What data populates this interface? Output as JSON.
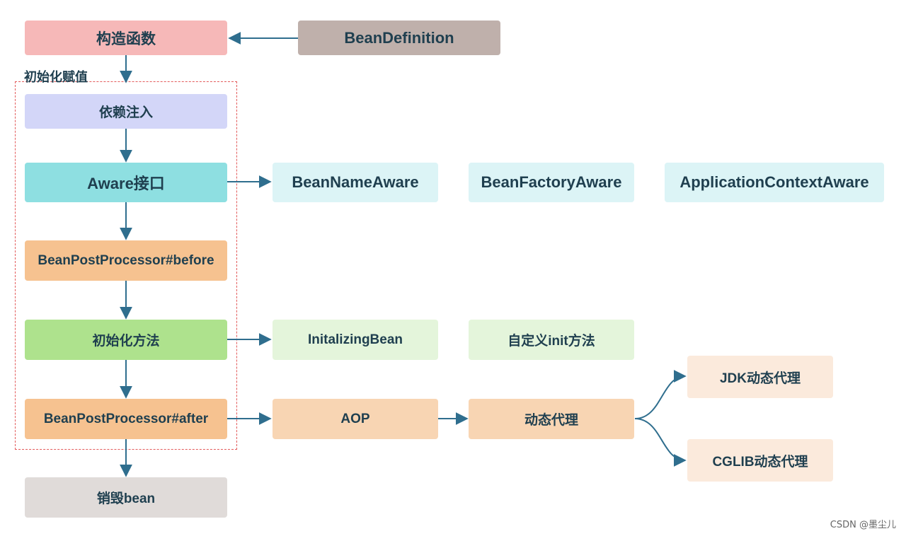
{
  "diagram": {
    "region_label": "初始化赋值",
    "nodes": {
      "constructor": {
        "label": "构造函数",
        "color": "#f6b8b8"
      },
      "bean_definition": {
        "label": "BeanDefinition",
        "color": "#bfb0ab"
      },
      "dependency_injection": {
        "label": "依赖注入",
        "color": "#d3d6f8"
      },
      "aware_interface": {
        "label": "Aware接口",
        "color": "#8edfe1"
      },
      "bean_name_aware": {
        "label": "BeanNameAware",
        "color": "#dcf4f6"
      },
      "bean_factory_aware": {
        "label": "BeanFactoryAware",
        "color": "#dcf4f6"
      },
      "application_context_aware": {
        "label": "ApplicationContextAware",
        "color": "#dcf4f6"
      },
      "post_processor_before": {
        "label": "BeanPostProcessor#before",
        "color": "#f6c290"
      },
      "init_method": {
        "label": "初始化方法",
        "color": "#aee28d"
      },
      "initializing_bean": {
        "label": "InitalizingBean",
        "color": "#e4f5db"
      },
      "custom_init": {
        "label": "自定义init方法",
        "color": "#e4f5db"
      },
      "post_processor_after": {
        "label": "BeanPostProcessor#after",
        "color": "#f6c290"
      },
      "aop": {
        "label": "AOP",
        "color": "#f8d5b3"
      },
      "dynamic_proxy": {
        "label": "动态代理",
        "color": "#f8d5b3"
      },
      "jdk_proxy": {
        "label": "JDK动态代理",
        "color": "#fbeadc"
      },
      "cglib_proxy": {
        "label": "CGLIB动态代理",
        "color": "#fbeadc"
      },
      "destroy_bean": {
        "label": "销毁bean",
        "color": "#e0dbd9"
      }
    },
    "edges": [
      [
        "bean_definition",
        "constructor"
      ],
      [
        "constructor",
        "dependency_injection"
      ],
      [
        "dependency_injection",
        "aware_interface"
      ],
      [
        "aware_interface",
        "bean_name_aware"
      ],
      [
        "aware_interface",
        "post_processor_before"
      ],
      [
        "post_processor_before",
        "init_method"
      ],
      [
        "init_method",
        "initializing_bean"
      ],
      [
        "init_method",
        "post_processor_after"
      ],
      [
        "post_processor_after",
        "aop"
      ],
      [
        "aop",
        "dynamic_proxy"
      ],
      [
        "dynamic_proxy",
        "jdk_proxy"
      ],
      [
        "dynamic_proxy",
        "cglib_proxy"
      ],
      [
        "post_processor_after",
        "destroy_bean"
      ]
    ],
    "edge_color": "#2f6e8e",
    "region_border_color": "#e35b5b"
  },
  "watermark": "CSDN @墨尘儿"
}
